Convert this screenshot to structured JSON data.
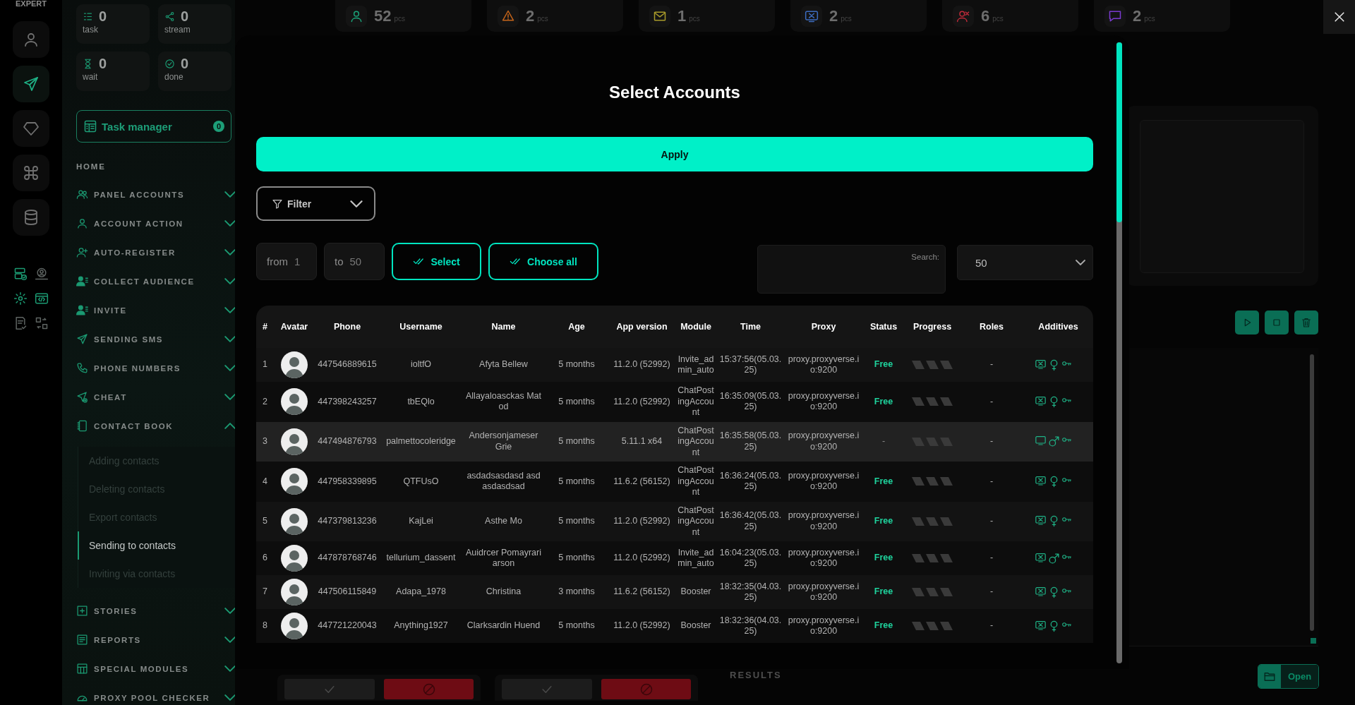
{
  "rail": {
    "brand": "EXPERT",
    "items": [
      {
        "selected": false
      },
      {
        "selected": true
      },
      {
        "selected": false
      },
      {
        "selected": false
      },
      {
        "selected": false
      }
    ]
  },
  "sidebar": {
    "stats": [
      {
        "value": "0",
        "label": "task"
      },
      {
        "value": "0",
        "label": "stream"
      },
      {
        "value": "0",
        "label": "wait"
      },
      {
        "value": "0",
        "label": "done"
      }
    ],
    "task_manager": {
      "label": "Task manager",
      "count": "0"
    },
    "menu": [
      {
        "kind": "heading",
        "label": "HOME"
      },
      {
        "kind": "group",
        "label": "PANEL ACCOUNTS",
        "expanded": false
      },
      {
        "kind": "group",
        "label": "ACCOUNT ACTION",
        "expanded": false
      },
      {
        "kind": "group",
        "label": "AUTO-REGISTER",
        "expanded": false
      },
      {
        "kind": "group",
        "label": "COLLECT AUDIENCE",
        "expanded": false
      },
      {
        "kind": "group",
        "label": "INVITE",
        "expanded": false
      },
      {
        "kind": "group",
        "label": "SENDING SMS",
        "expanded": false
      },
      {
        "kind": "group",
        "label": "PHONE NUMBERS",
        "expanded": false
      },
      {
        "kind": "group",
        "label": "CHEAT",
        "expanded": false
      },
      {
        "kind": "group",
        "label": "CONTACT BOOK",
        "expanded": true,
        "children": [
          {
            "label": "Adding contacts",
            "selected": false
          },
          {
            "label": "Deleting contacts",
            "selected": false
          },
          {
            "label": "Export contacts",
            "selected": false
          },
          {
            "label": "Sending to contacts",
            "selected": true
          },
          {
            "label": "Inviting via contacts",
            "selected": false
          }
        ]
      },
      {
        "kind": "group",
        "label": "STORIES",
        "expanded": false
      },
      {
        "kind": "group",
        "label": "REPORTS",
        "expanded": false
      },
      {
        "kind": "group",
        "label": "SPECIAL MODULES",
        "expanded": false
      },
      {
        "kind": "group",
        "label": "PROXY POOL CHECKER",
        "expanded": false
      }
    ]
  },
  "background": {
    "counters": [
      {
        "value": "52",
        "unit": "pcs",
        "color": "#1aa57a"
      },
      {
        "value": "2",
        "unit": "pcs",
        "color": "#c4641a"
      },
      {
        "value": "1",
        "unit": "pcs",
        "color": "#a89a2a"
      },
      {
        "value": "2",
        "unit": "pcs",
        "color": "#3c6cc0"
      },
      {
        "value": "6",
        "unit": "pcs",
        "color": "#c02a3a"
      },
      {
        "value": "2",
        "unit": "pcs",
        "color": "#7a3ad0"
      }
    ],
    "results_label": "RESULTS",
    "open_button": "Open"
  },
  "modal": {
    "title": "Select Accounts",
    "apply_button": "Apply",
    "filter_button": "Filter",
    "from_label": "from",
    "from_value": "1",
    "to_label": "to",
    "to_value": "50",
    "select_button": "Select",
    "choose_all_button": "Choose all",
    "search_label": "Search:",
    "page_size": "50",
    "table": {
      "columns": [
        "#",
        "Avatar",
        "Phone",
        "Username",
        "Name",
        "Age",
        "App version",
        "Module",
        "Time",
        "Proxy",
        "Status",
        "Progress",
        "Roles",
        "Additives"
      ],
      "rows": [
        {
          "number": "1",
          "phone": "447546889615",
          "username": "ioltfO",
          "name": "Afyta Bellew",
          "age": "5 months",
          "app_version": "11.2.0 (52992)",
          "module": "Invite_admin_auto",
          "time": "15:37:56(05.03.25)",
          "proxy": "proxy.proxyverse.io:9200",
          "status": "Free",
          "status_ok": true,
          "roles": "-",
          "blocked": true,
          "male": false,
          "highlighted": false
        },
        {
          "number": "2",
          "phone": "447398243257",
          "username": "tbEQlo",
          "name": "Allayaloasckas Matod",
          "age": "5 months",
          "app_version": "11.2.0 (52992)",
          "module": "ChatPostingAccount",
          "time": "16:35:09(05.03.25)",
          "proxy": "proxy.proxyverse.io:9200",
          "status": "Free",
          "status_ok": true,
          "roles": "-",
          "blocked": true,
          "male": false,
          "highlighted": false
        },
        {
          "number": "3",
          "phone": "447494876793",
          "username": "palmettocoleridge",
          "name": "Andersonjameser Grie",
          "age": "5 months",
          "app_version": "5.11.1 x64",
          "module": "ChatPostingAccount",
          "time": "16:35:58(05.03.25)",
          "proxy": "proxy.proxyverse.io:9200",
          "status": "-",
          "status_ok": false,
          "roles": "-",
          "blocked": false,
          "male": true,
          "highlighted": true
        },
        {
          "number": "4",
          "phone": "447958339895",
          "username": "QTFUsO",
          "name": "asdadsasdasd asdasdasdsad",
          "age": "5 months",
          "app_version": "11.6.2 (56152)",
          "module": "ChatPostingAccount",
          "time": "16:36:24(05.03.25)",
          "proxy": "proxy.proxyverse.io:9200",
          "status": "Free",
          "status_ok": true,
          "roles": "-",
          "blocked": true,
          "male": false,
          "highlighted": false
        },
        {
          "number": "5",
          "phone": "447379813236",
          "username": "KajLei",
          "name": "Asthe Mo",
          "age": "5 months",
          "app_version": "11.2.0 (52992)",
          "module": "ChatPostingAccount",
          "time": "16:36:42(05.03.25)",
          "proxy": "proxy.proxyverse.io:9200",
          "status": "Free",
          "status_ok": true,
          "roles": "-",
          "blocked": true,
          "male": false,
          "highlighted": false
        },
        {
          "number": "6",
          "phone": "447878768746",
          "username": "tellurium_dassent",
          "name": "Auidrcer Pomayrariarson",
          "age": "5 months",
          "app_version": "11.2.0 (52992)",
          "module": "Invite_admin_auto",
          "time": "16:04:23(05.03.25)",
          "proxy": "proxy.proxyverse.io:9200",
          "status": "Free",
          "status_ok": true,
          "roles": "-",
          "blocked": true,
          "male": true,
          "highlighted": false
        },
        {
          "number": "7",
          "phone": "447506115849",
          "username": "Adapa_1978",
          "name": "Christina",
          "age": "3 months",
          "app_version": "11.6.2 (56152)",
          "module": "Booster",
          "time": "18:32:35(04.03.25)",
          "proxy": "proxy.proxyverse.io:9200",
          "status": "Free",
          "status_ok": true,
          "roles": "-",
          "blocked": true,
          "male": false,
          "highlighted": false
        },
        {
          "number": "8",
          "phone": "447721220043",
          "username": "Anything1927",
          "name": "Clarksardin Huend",
          "age": "5 months",
          "app_version": "11.2.0 (52992)",
          "module": "Booster",
          "time": "18:32:36(04.03.25)",
          "proxy": "proxy.proxyverse.io:9200",
          "status": "Free",
          "status_ok": true,
          "roles": "-",
          "blocked": true,
          "male": false,
          "highlighted": false
        }
      ]
    }
  }
}
